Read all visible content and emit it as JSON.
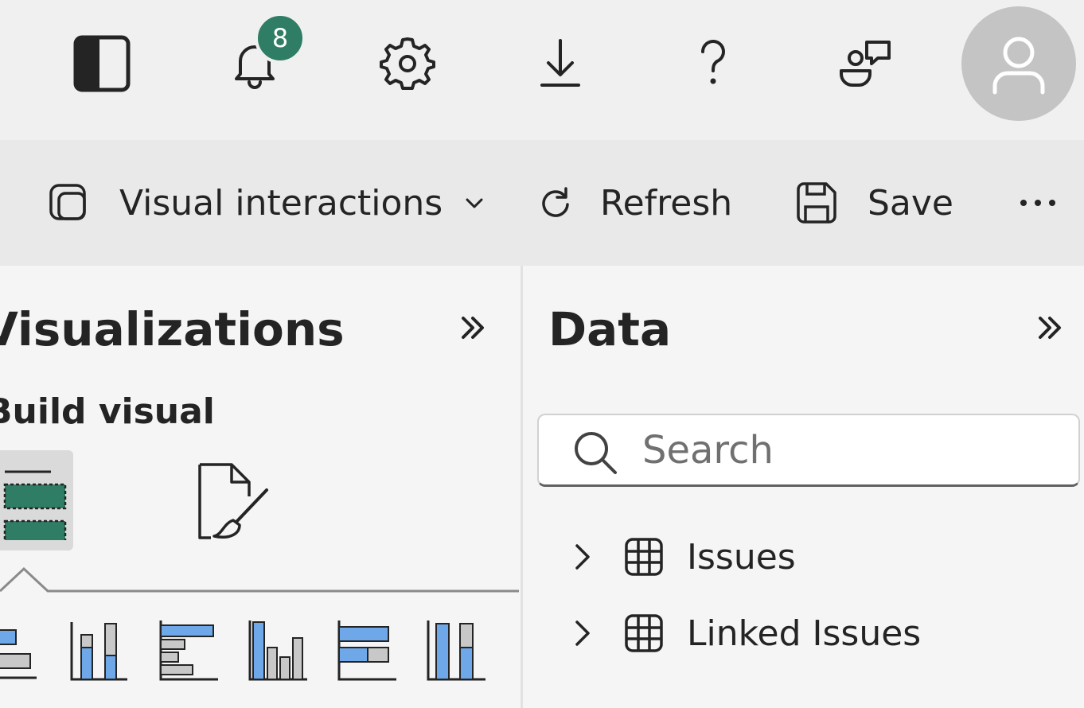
{
  "topbar": {
    "icons": [
      "panel-toggle-icon",
      "bell-icon",
      "gear-icon",
      "download-icon",
      "help-icon",
      "feedback-icon",
      "person-icon"
    ],
    "notification_count": "8",
    "colors": {
      "badge": "#2e7d64",
      "avatar": "#c4c4c4",
      "background": "#f0f0f0"
    }
  },
  "command_bar": {
    "visual_interactions_label": "Visual interactions",
    "refresh_label": "Refresh",
    "save_label": "Save",
    "more_label": "···"
  },
  "visualizations_pane": {
    "title": "Visualizations",
    "build_visual_label": "Build visual",
    "tiles": [
      "build-visual-icon",
      "format-visual-icon"
    ],
    "chart_types": [
      "stacked-bar-chart-icon",
      "stacked-column-chart-icon",
      "clustered-bar-chart-icon",
      "clustered-column-chart-icon",
      "100-stacked-bar-chart-icon",
      "100-stacked-column-chart-icon"
    ],
    "colors": {
      "accent_green": "#2e7d64",
      "chart_blue": "#6fa8e8",
      "chart_gray": "#c8c8c8"
    }
  },
  "data_pane": {
    "title": "Data",
    "search": {
      "placeholder": "Search",
      "value": ""
    },
    "tables": [
      {
        "label": "Issues",
        "icon": "table-icon"
      },
      {
        "label": "Linked Issues",
        "icon": "table-icon"
      }
    ]
  }
}
